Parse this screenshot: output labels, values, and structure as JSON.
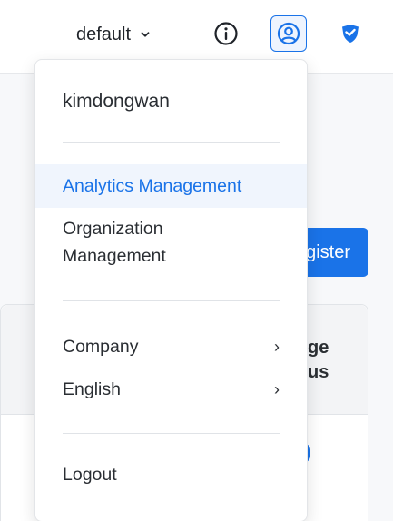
{
  "header": {
    "project": "default",
    "icons": {
      "chevron": "chevron-down-icon",
      "info": "info-icon",
      "user": "user-circle-icon",
      "shield": "shield-icon"
    },
    "accent_color": "#1a73e8"
  },
  "background": {
    "register_button_label": "gister",
    "column_title_line1": "ge",
    "column_title_line2": "us"
  },
  "menu": {
    "username": "kimdongwan",
    "items": [
      {
        "label": "Analytics Management",
        "active": true
      },
      {
        "label_line1": "Organization",
        "label_line2": "Management"
      },
      {
        "label": "Company",
        "submenu": true
      },
      {
        "label": "English",
        "submenu": true
      },
      {
        "label": "Logout"
      }
    ],
    "submenu_arrow": "›"
  }
}
